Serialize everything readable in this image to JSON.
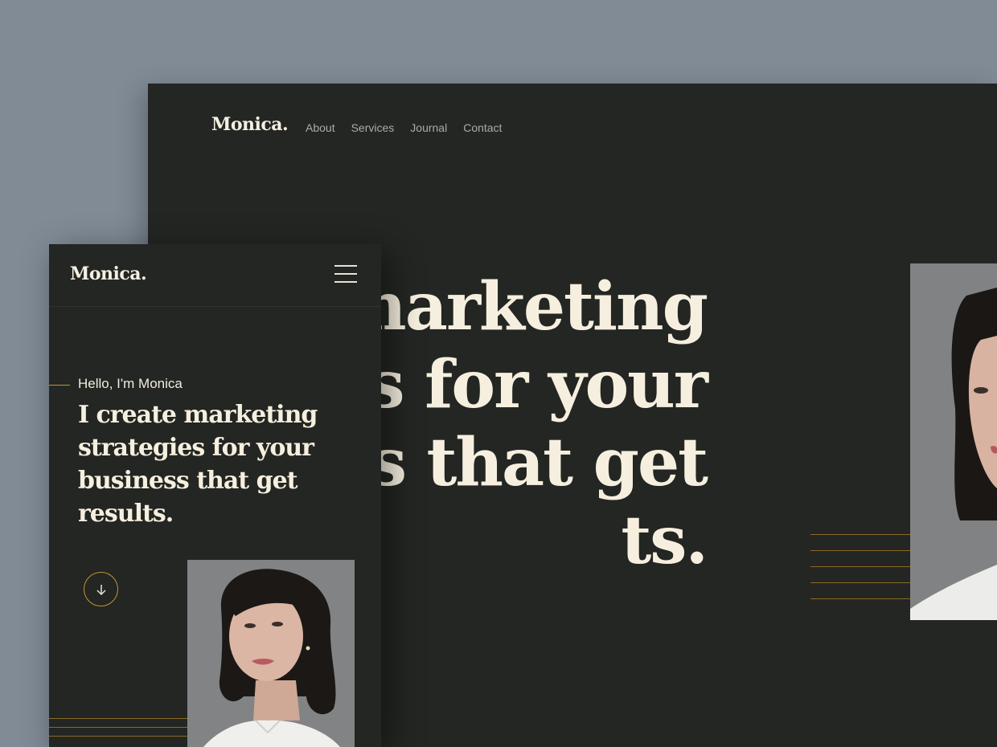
{
  "desktop": {
    "logo": "Monica.",
    "nav": [
      "About",
      "Services",
      "Journal",
      "Contact"
    ],
    "hero_lines": [
      "ate marketing",
      "egies for your",
      "ness that get",
      "ts."
    ]
  },
  "mobile": {
    "logo": "Monica.",
    "eyebrow": "Hello, I'm Monica",
    "title": "I create marketing strategies for your business that get results."
  },
  "colors": {
    "background": "#808b96",
    "panel": "#232622",
    "accent": "#c8922e",
    "headline": "#f6efdf",
    "nav_text": "#a9ada3"
  },
  "icons": {
    "menu": "hamburger-icon",
    "scroll": "arrow-down-icon"
  }
}
